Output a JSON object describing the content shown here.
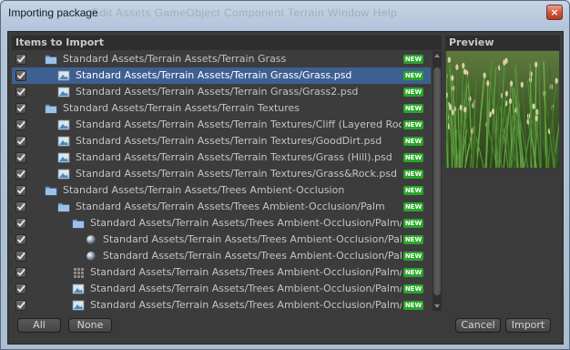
{
  "window": {
    "title": "Importing package",
    "ghost_menu": "Edit   Assets   GameObject   Component   Terrain   Window   Help",
    "close_label": "×"
  },
  "items_panel": {
    "header": "Items to Import",
    "new_badge": "NEW",
    "rows": [
      {
        "label": "Standard Assets/Terrain Assets/Terrain Grass",
        "icon": "folder-icon",
        "checked": true,
        "indent": 1,
        "selected": false
      },
      {
        "label": "Standard Assets/Terrain Assets/Terrain Grass/Grass.psd",
        "icon": "image-icon",
        "checked": true,
        "indent": 2,
        "selected": true
      },
      {
        "label": "Standard Assets/Terrain Assets/Terrain Grass/Grass2.psd",
        "icon": "image-icon",
        "checked": true,
        "indent": 2,
        "selected": false
      },
      {
        "label": "Standard Assets/Terrain Assets/Terrain Textures",
        "icon": "folder-icon",
        "checked": true,
        "indent": 1,
        "selected": false
      },
      {
        "label": "Standard Assets/Terrain Assets/Terrain Textures/Cliff (Layered Rock).psd",
        "icon": "image-icon",
        "checked": true,
        "indent": 2,
        "selected": false
      },
      {
        "label": "Standard Assets/Terrain Assets/Terrain Textures/GoodDirt.psd",
        "icon": "image-icon",
        "checked": true,
        "indent": 2,
        "selected": false
      },
      {
        "label": "Standard Assets/Terrain Assets/Terrain Textures/Grass (Hill).psd",
        "icon": "image-icon",
        "checked": true,
        "indent": 2,
        "selected": false
      },
      {
        "label": "Standard Assets/Terrain Assets/Terrain Textures/Grass&Rock.psd",
        "icon": "image-icon",
        "checked": true,
        "indent": 2,
        "selected": false
      },
      {
        "label": "Standard Assets/Terrain Assets/Trees Ambient-Occlusion",
        "icon": "folder-icon",
        "checked": true,
        "indent": 1,
        "selected": false
      },
      {
        "label": "Standard Assets/Terrain Assets/Trees Ambient-Occlusion/Palm",
        "icon": "folder-icon",
        "checked": true,
        "indent": 2,
        "selected": false
      },
      {
        "label": "Standard Assets/Terrain Assets/Trees Ambient-Occlusion/Palm/Materials",
        "icon": "folder-icon",
        "checked": true,
        "indent": 3,
        "selected": false
      },
      {
        "label": "Standard Assets/Terrain Assets/Trees Ambient-Occlusion/Palm/Materials/Palm.mat",
        "icon": "material-sphere-icon",
        "checked": true,
        "indent": 4,
        "selected": false
      },
      {
        "label": "Standard Assets/Terrain Assets/Trees Ambient-Occlusion/Palm/Materials/PalmBark.mat",
        "icon": "material-sphere-icon",
        "checked": true,
        "indent": 4,
        "selected": false
      },
      {
        "label": "Standard Assets/Terrain Assets/Trees Ambient-Occlusion/Palm/Palm.fbx",
        "icon": "mesh-grid-icon",
        "checked": true,
        "indent": 3,
        "selected": false
      },
      {
        "label": "Standard Assets/Terrain Assets/Trees Ambient-Occlusion/Palm/Palm.psd",
        "icon": "image-icon",
        "checked": true,
        "indent": 3,
        "selected": false
      },
      {
        "label": "Standard Assets/Terrain Assets/Trees Ambient-Occlusion/Palm/PalmBark.psd",
        "icon": "image-icon",
        "checked": true,
        "indent": 3,
        "selected": false
      }
    ]
  },
  "preview_panel": {
    "header": "Preview"
  },
  "footer": {
    "all_label": "All",
    "none_label": "None",
    "cancel_label": "Cancel",
    "import_label": "Import"
  },
  "colors": {
    "selection": "#3d6091",
    "panel_bg": "#3c3c3c",
    "new_badge": "#2aa52a"
  }
}
